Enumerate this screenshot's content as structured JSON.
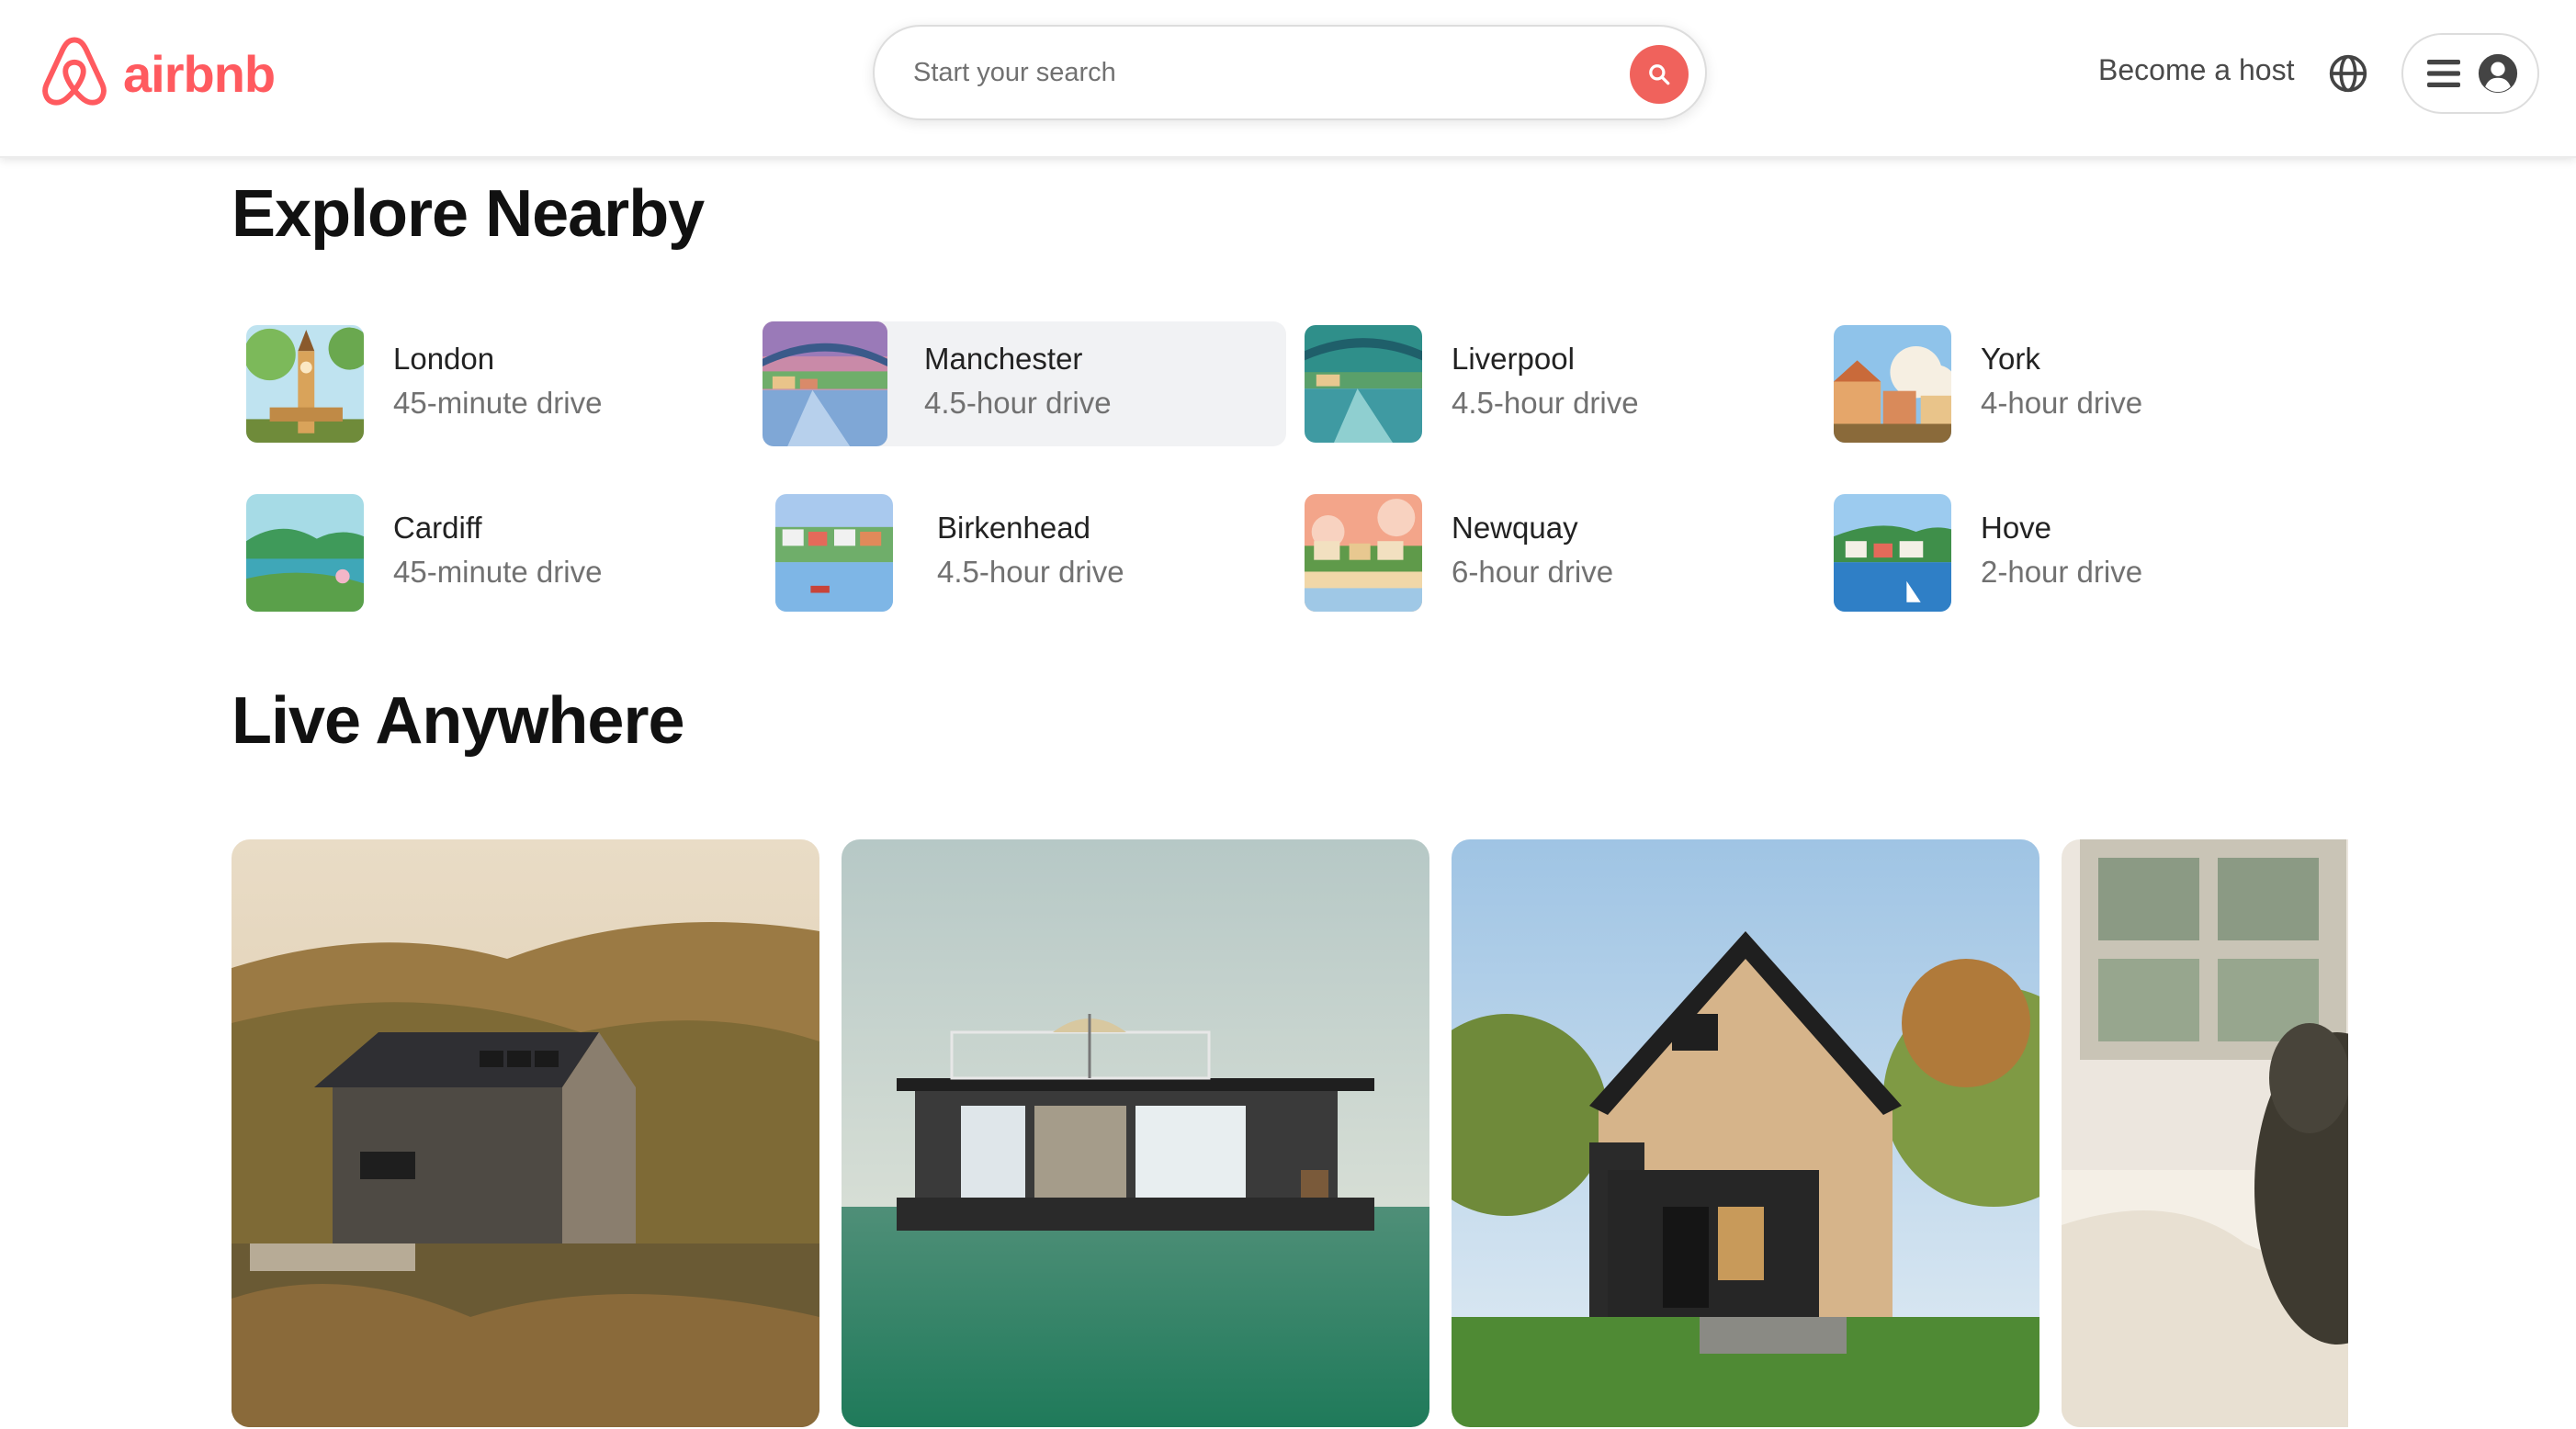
{
  "brand": {
    "name": "airbnb",
    "color": "#FF5A5F"
  },
  "search": {
    "placeholder": "Start your search",
    "icon": "search-icon"
  },
  "nav": {
    "become_host": "Become a host",
    "globe_icon": "globe-icon",
    "menu_icon": "hamburger-menu-icon",
    "avatar_icon": "user-avatar-icon"
  },
  "explore": {
    "title": "Explore Nearby",
    "places": [
      {
        "name": "London",
        "drive": "45-minute drive"
      },
      {
        "name": "Manchester",
        "drive": "4.5-hour drive"
      },
      {
        "name": "Liverpool",
        "drive": "4.5-hour drive"
      },
      {
        "name": "York",
        "drive": "4-hour drive"
      },
      {
        "name": "Cardiff",
        "drive": "45-minute drive"
      },
      {
        "name": "Birkenhead",
        "drive": "4.5-hour drive"
      },
      {
        "name": "Newquay",
        "drive": "6-hour drive"
      },
      {
        "name": "Hove",
        "drive": "2-hour drive"
      }
    ]
  },
  "live": {
    "title": "Live Anywhere",
    "cards": [
      {
        "image": "wooden-cabin-hillside-image"
      },
      {
        "image": "floating-houseboat-image"
      },
      {
        "image": "a-frame-wooden-house-image"
      },
      {
        "image": "dog-on-bed-image"
      }
    ]
  }
}
